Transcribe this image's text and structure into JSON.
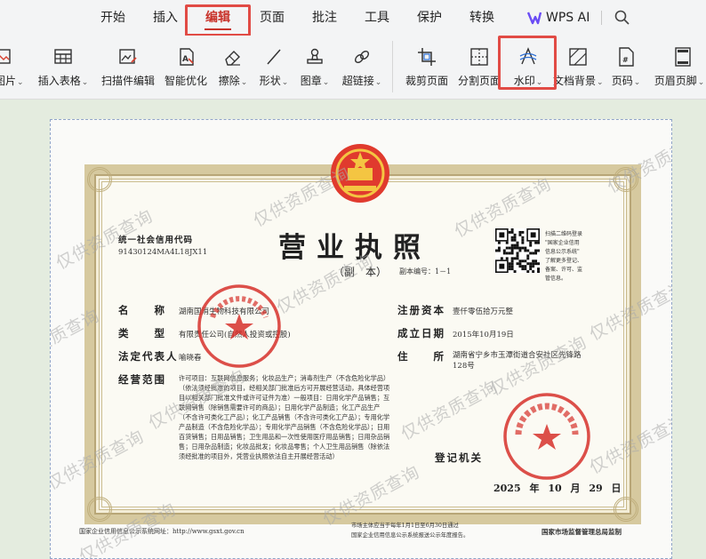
{
  "menubar": {
    "items": [
      "开始",
      "插入",
      "编辑",
      "页面",
      "批注",
      "工具",
      "保护",
      "转换"
    ],
    "active_index": 2,
    "ai_label": "WPS AI"
  },
  "toolbar": {
    "left_items": [
      "图片",
      "插入表格",
      "扫描件编辑",
      "智能优化",
      "擦除",
      "形状",
      "图章",
      "超链接"
    ],
    "right_items": [
      "裁剪页面",
      "分割页面",
      "水印",
      "文档背景",
      "页码",
      "页眉页脚"
    ],
    "highlighted": "水印"
  },
  "colors": {
    "accent": "#c8322a",
    "highlight_box": "#e14b45",
    "seal": "#d6302a"
  },
  "license": {
    "title": "营业执照",
    "subtitle": "（副　本）",
    "copy_number": "副本编号：1－1",
    "credit_code_label": "统一社会信用代码",
    "credit_code": "91430124MA4L18JX11",
    "qr_note": "扫描二维码登录\n\"国家企业信用\n信息公示系统\"\n了解更多登记、\n备案、许可、监\n管信息。",
    "fields": {
      "name_label": "名　　称",
      "name_value": "湖南国消生物科技有限公司",
      "type_label": "类　　型",
      "type_value": "有限责任公司(自然人投资或控股)",
      "legal_label": "法定代表人",
      "legal_value": "喻晓春",
      "scope_label": "经营范围",
      "scope_value": "许可项目：互联网信息服务；化妆品生产；消毒剂生产（不含危险化学品）（依法须经批准的项目，经相关部门批准后方可开展经营活动，具体经营项目以相关部门批准文件或许可证件为准）一般项目：日用化学产品销售；互联网销售（除销售需要许可的商品）；日用化学产品制造；化工产品生产（不含许可类化工产品）；化工产品销售（不含许可类化工产品）；专用化学产品制造（不含危险化学品）；专用化学产品销售（不含危险化学品）；日用百货销售；日用品销售；卫生用品和一次性使用医疗用品销售；日用杂品销售；日用杂品制造；化妆品批发；化妆品零售；个人卫生用品销售（除依法须经批准的项目外，凭营业执照依法自主开展经营活动）",
      "capital_label": "注册资本",
      "capital_value": "壹仟零伍拾万元整",
      "date_label": "成立日期",
      "date_value": "2015年10月19日",
      "address_label": "住　　所",
      "address_value": "湖南省宁乡市玉潭街道合安社区先锋路128号"
    },
    "registrar_label": "登记机关",
    "reg_year": "2025",
    "reg_year_unit": "年",
    "reg_month": "10",
    "reg_month_unit": "月",
    "reg_day": "29",
    "reg_day_unit": "日",
    "footer_left": "国家企业信用信息公示系统网址：http://www.gsxt.gov.cn",
    "footer_mid_1": "市场主体应当于每年1月1日至6月30日通过",
    "footer_mid_2": "国家企业信用信息公示系统报送公示年度报告。",
    "footer_right": "国家市场监督管理总局监制",
    "watermark_text": "仅供资质查询"
  }
}
